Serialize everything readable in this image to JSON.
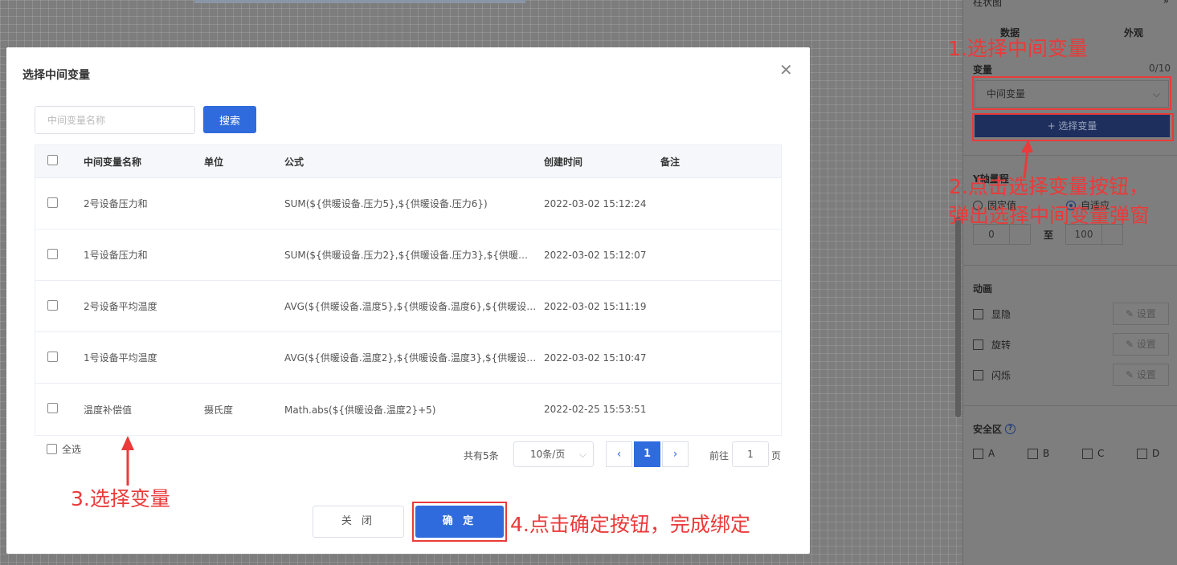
{
  "right_panel": {
    "title": "柱状图",
    "collapse_icon": "»",
    "tabs": [
      "数据",
      "外观"
    ],
    "variable_label": "变量",
    "variable_count": "0/10",
    "variable_select_value": "中间变量",
    "select_variable_button": "+ 选择变量",
    "y_axis_label": "Y轴量程",
    "y_axis_options": [
      "固定值",
      "自适应"
    ],
    "y_axis_selected": "自适应",
    "range_from": "0",
    "range_to_label": "至",
    "range_to": "100",
    "animation_label": "动画",
    "animation_items": [
      "显隐",
      "旋转",
      "闪烁"
    ],
    "setting_button": "设置",
    "safe_zone_label": "安全区",
    "safe_zones": [
      "A",
      "B",
      "C",
      "D"
    ]
  },
  "modal": {
    "title": "选择中间变量",
    "search_placeholder": "中间变量名称",
    "search_button": "搜索",
    "columns": [
      "中间变量名称",
      "单位",
      "公式",
      "创建时间",
      "备注"
    ],
    "rows": [
      {
        "name": "2号设备压力和",
        "unit": "",
        "formula": "SUM(${供暖设备.压力5},${供暖设备.压力6})",
        "created": "2022-03-02 15:12:24",
        "note": ""
      },
      {
        "name": "1号设备压力和",
        "unit": "",
        "formula": "SUM(${供暖设备.压力2},${供暖设备.压力3},${供暖设备...",
        "created": "2022-03-02 15:12:07",
        "note": ""
      },
      {
        "name": "2号设备平均温度",
        "unit": "",
        "formula": "AVG(${供暖设备.温度5},${供暖设备.温度6},${供暖设备....",
        "created": "2022-03-02 15:11:19",
        "note": ""
      },
      {
        "name": "1号设备平均温度",
        "unit": "",
        "formula": "AVG(${供暖设备.温度2},${供暖设备.温度3},${供暖设备....",
        "created": "2022-03-02 15:10:47",
        "note": ""
      },
      {
        "name": "温度补偿值",
        "unit": "摄氏度",
        "formula": "Math.abs(${供暖设备.温度2}+5)",
        "created": "2022-02-25 15:53:51",
        "note": ""
      }
    ],
    "select_all": "全选",
    "pagination": {
      "total": "共有5条",
      "page_size": "10条/页",
      "current_page": "1",
      "goto_label": "前往",
      "goto_value": "1",
      "goto_unit": "页"
    },
    "close_button": "关 闭",
    "confirm_button": "确 定"
  },
  "annotations": {
    "step1": "1.选择中间变量",
    "step2_line1": "2.点击选择变量按钮，",
    "step2_line2": "弹出选择中间变量弹窗",
    "step3": "3.选择变量",
    "step4": "4.点击确定按钮，完成绑定"
  },
  "colors": {
    "primary": "#2f6bdc",
    "annotation": "#ea3a3a",
    "overlay": "#7d7d7d"
  }
}
